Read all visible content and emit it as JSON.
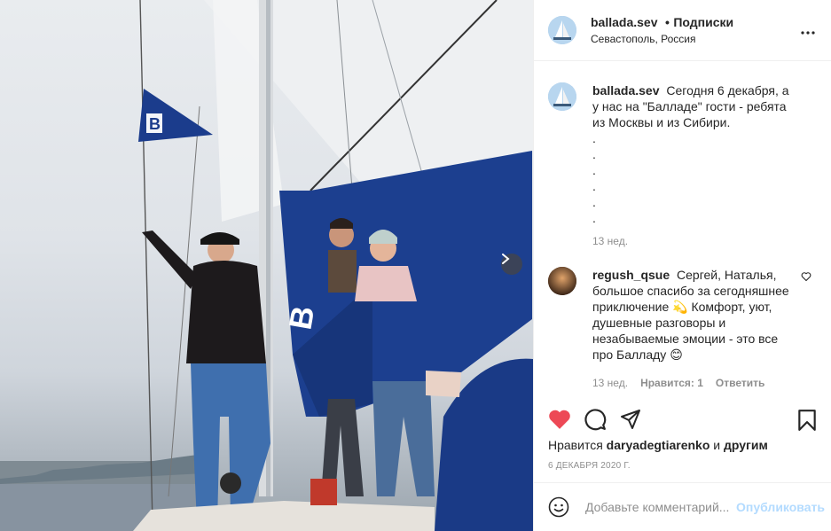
{
  "post": {
    "author": "ballada.sev",
    "separator": "•",
    "follow_label": "Подписки",
    "location": "Севастополь, Россия",
    "more_icon": "more-horizontal-icon"
  },
  "caption": {
    "username": "ballada.sev",
    "text": "Сегодня 6 декабря, а у нас на \"Балладе\" гости - ребята из Москвы и из Сибири.",
    "dots": [
      ".",
      ".",
      ".",
      ".",
      ".",
      "."
    ],
    "time": "13 нед."
  },
  "comment": {
    "username": "regush_qsue",
    "text": "Сергей, Наталья, большое спасибо за сегодняшнее приключение 💫 Комфорт, уют, душевные разговоры и незабываемые эмоции - это все про Балладу 😊",
    "time": "13 нед.",
    "likes": "Нравится: 1",
    "reply_label": "Ответить"
  },
  "liked_by": {
    "prefix": "Нравится",
    "user": "daryadegtiarenko",
    "conj": "и",
    "others": "другим"
  },
  "date": "6 ДЕКАБРЯ 2020 Г.",
  "add_comment": {
    "placeholder": "Добавьте комментарий...",
    "publish_label": "Опубликовать"
  },
  "colors": {
    "like_red": "#ed4956",
    "publish_blue": "#b3dbff",
    "muted": "#8e8e8e",
    "sail_blue": "#1c3f8f"
  },
  "photo": {
    "flag_letter": "B",
    "sail_letter": "B"
  }
}
